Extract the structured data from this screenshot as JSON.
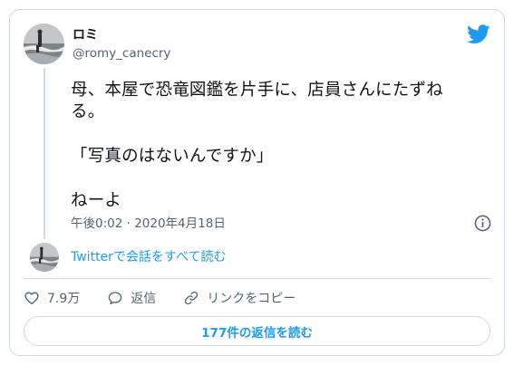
{
  "author": {
    "display_name": "ロミ",
    "handle": "@romy_canecry"
  },
  "tweet": {
    "lines": [
      "母、本屋で恐竜図鑑を片手に、店員さんにたずね",
      "る。",
      "「写真のはないんですか」",
      "ねーよ"
    ],
    "timestamp": "午後0:02 · 2020年4月18日"
  },
  "conversation": {
    "link_label": "Twitterで会話をすべて読む"
  },
  "actions": {
    "like_count": "7.9万",
    "reply_label": "返信",
    "copy_link_label": "リンクをコピー"
  },
  "replies_button": {
    "label": "177件の返信を読む"
  },
  "icons": {
    "brand": "twitter-bird-icon",
    "info": "info-icon",
    "like": "heart-icon",
    "reply": "speech-bubble-icon",
    "link": "link-icon"
  },
  "colors": {
    "accent": "#1d9bf0",
    "text": "#0f1419",
    "secondary_text": "#536471",
    "border": "#cfd9de"
  }
}
